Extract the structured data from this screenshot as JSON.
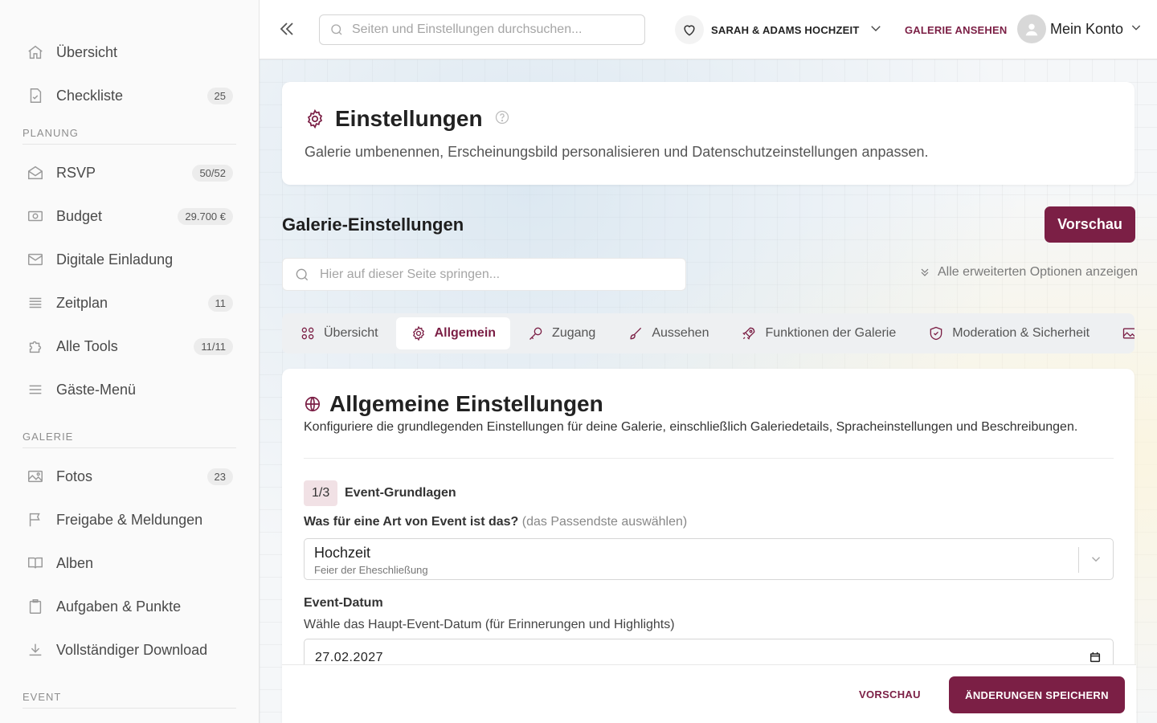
{
  "sidebar": {
    "top_items": [
      {
        "label": "Übersicht",
        "icon": "home-icon"
      },
      {
        "label": "Checkliste",
        "icon": "checklist-icon",
        "badge": "25"
      }
    ],
    "sections": [
      {
        "heading": "PLANUNG",
        "items": [
          {
            "label": "RSVP",
            "icon": "envelope-open-icon",
            "badge": "50/52"
          },
          {
            "label": "Budget",
            "icon": "money-icon",
            "badge": "29.700 €"
          },
          {
            "label": "Digitale Einladung",
            "icon": "mail-icon"
          },
          {
            "label": "Zeitplan",
            "icon": "timeline-icon",
            "badge": "11"
          },
          {
            "label": "Alle Tools",
            "icon": "puzzle-icon",
            "badge": "11/11"
          },
          {
            "label": "Gäste-Menü",
            "icon": "menu-icon"
          }
        ]
      },
      {
        "heading": "GALERIE",
        "items": [
          {
            "label": "Fotos",
            "icon": "image-icon",
            "badge": "23"
          },
          {
            "label": "Freigabe & Meldungen",
            "icon": "flag-icon"
          },
          {
            "label": "Alben",
            "icon": "book-icon"
          },
          {
            "label": "Aufgaben & Punkte",
            "icon": "clipboard-icon"
          },
          {
            "label": "Vollständiger Download",
            "icon": "download-icon"
          }
        ]
      },
      {
        "heading": "EVENT",
        "items": []
      }
    ]
  },
  "topbar": {
    "search_placeholder": "Seiten und Einstellungen durchsuchen...",
    "gallery_name": "SARAH & ADAMS HOCHZEIT",
    "view_gallery": "GALERIE ANSEHEN",
    "account_label": "Mein Konto"
  },
  "header": {
    "title": "Einstellungen",
    "subtitle": "Galerie umbenennen, Erscheinungsbild personalisieren und Datenschutzeinstellungen anpassen."
  },
  "gallery_settings": {
    "title": "Galerie-Einstellungen",
    "preview_label": "Vorschau",
    "jump_placeholder": "Hier auf dieser Seite springen...",
    "advanced_label": "Alle erweiterten Optionen anzeigen"
  },
  "tabs": [
    {
      "label": "Übersicht",
      "icon": "grid-icon",
      "active": false
    },
    {
      "label": "Allgemein",
      "icon": "gear-icon",
      "active": true
    },
    {
      "label": "Zugang",
      "icon": "key-icon",
      "active": false
    },
    {
      "label": "Aussehen",
      "icon": "brush-icon",
      "active": false
    },
    {
      "label": "Funktionen der Galerie",
      "icon": "rocket-icon",
      "active": false
    },
    {
      "label": "Moderation & Sicherheit",
      "icon": "shield-icon",
      "active": false
    },
    {
      "label": "",
      "icon": "image-icon",
      "active": false
    }
  ],
  "general": {
    "title": "Allgemeine Einstellungen",
    "description": "Konfiguriere die grundlegenden Einstellungen für deine Galerie, einschließlich Galeriedetails, Spracheinstellungen und Beschreibungen.",
    "step_badge": "1/3",
    "step_name": "Event-Grundlagen",
    "event_type_question": "Was für eine Art von Event ist das?",
    "event_type_hint": "(das Passendste auswählen)",
    "event_type_value": "Hochzeit",
    "event_type_desc": "Feier der Eheschließung",
    "date_label": "Event-Datum",
    "date_help": "Wähle das Haupt-Event-Datum (für Erinnerungen und Highlights)",
    "date_value": "27.02.2027"
  },
  "footer": {
    "preview_label": "VORSCHAU",
    "save_label": "ÄNDERUNGEN SPEICHERN"
  },
  "colors": {
    "accent": "#7b1f45",
    "sidebar_bg": "#fafafa"
  }
}
